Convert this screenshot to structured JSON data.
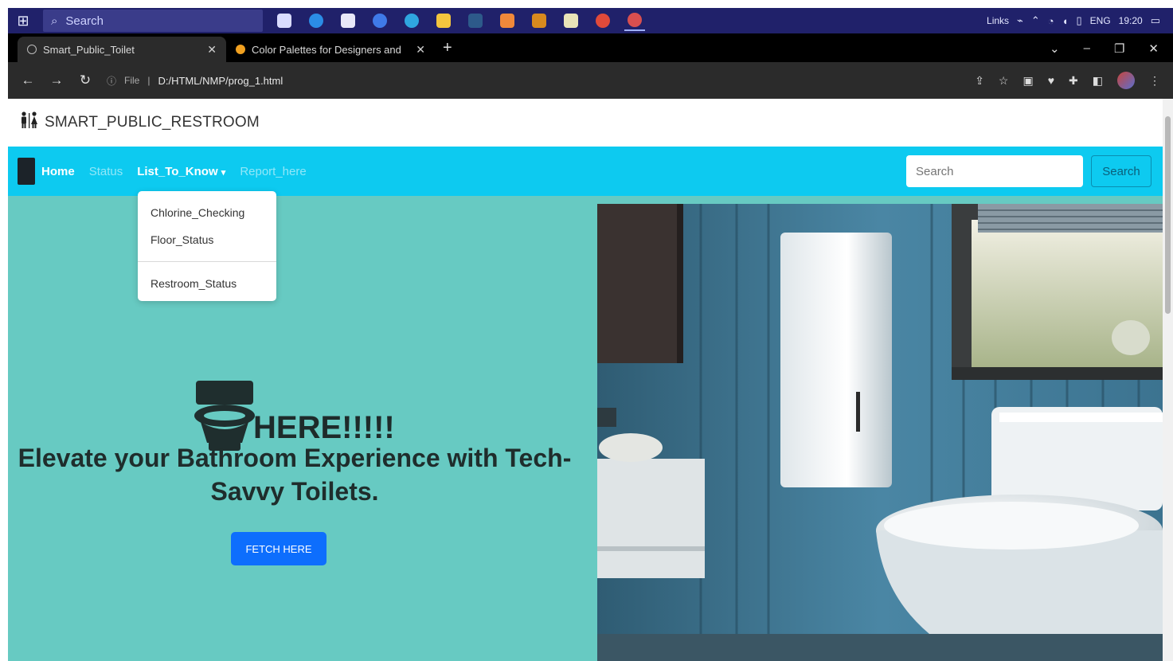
{
  "taskbar": {
    "search_placeholder": "Search",
    "tray_text": [
      "Links",
      "ENG",
      "19:20"
    ],
    "apps": [
      {
        "name": "task-view-icon",
        "color": "#d9dcff"
      },
      {
        "name": "edge-icon",
        "color": "#2b8de6"
      },
      {
        "name": "store-icon",
        "color": "#e8e8f8"
      },
      {
        "name": "app-blue-icon",
        "color": "#3f7ae8"
      },
      {
        "name": "app-teal-icon",
        "color": "#2fa6e0"
      },
      {
        "name": "file-explorer-icon",
        "color": "#f3c53e"
      },
      {
        "name": "terminal-icon",
        "color": "#2d5a8a"
      },
      {
        "name": "app-orange-icon",
        "color": "#f0883a"
      },
      {
        "name": "app-yellow-icon",
        "color": "#d88a1e"
      },
      {
        "name": "notepad-icon",
        "color": "#e9e4b8"
      },
      {
        "name": "chrome-icon",
        "color": "#e04a3a"
      },
      {
        "name": "chrome-active-icon",
        "color": "#d94f4f"
      }
    ]
  },
  "browser": {
    "tabs": [
      {
        "label": "Smart_Public_Toilet",
        "active": true
      },
      {
        "label": "Color Palettes for Designers and",
        "active": false
      }
    ],
    "url_prefix": "File",
    "url": "D:/HTML/NMP/prog_1.html"
  },
  "site": {
    "brand": "SMART_PUBLIC_RESTROOM",
    "nav": {
      "home": "Home",
      "status": "Status",
      "list": "List_To_Know",
      "report": "Report_here"
    },
    "dropdown": {
      "items": [
        "Chlorine_Checking",
        "Floor_Status"
      ],
      "after_divider": "Restroom_Status"
    },
    "search": {
      "placeholder": "Search",
      "button": "Search"
    },
    "hero": {
      "heading": "HERE!!!!!",
      "tagline": "Elevate your Bathroom Experience with Tech-Savvy Toilets.",
      "button": "FETCH HERE"
    }
  },
  "colors": {
    "navbar": "#0dcaf0",
    "hero_bg": "#67cac2",
    "button_primary": "#0d6efd",
    "taskbar": "#20216a"
  }
}
